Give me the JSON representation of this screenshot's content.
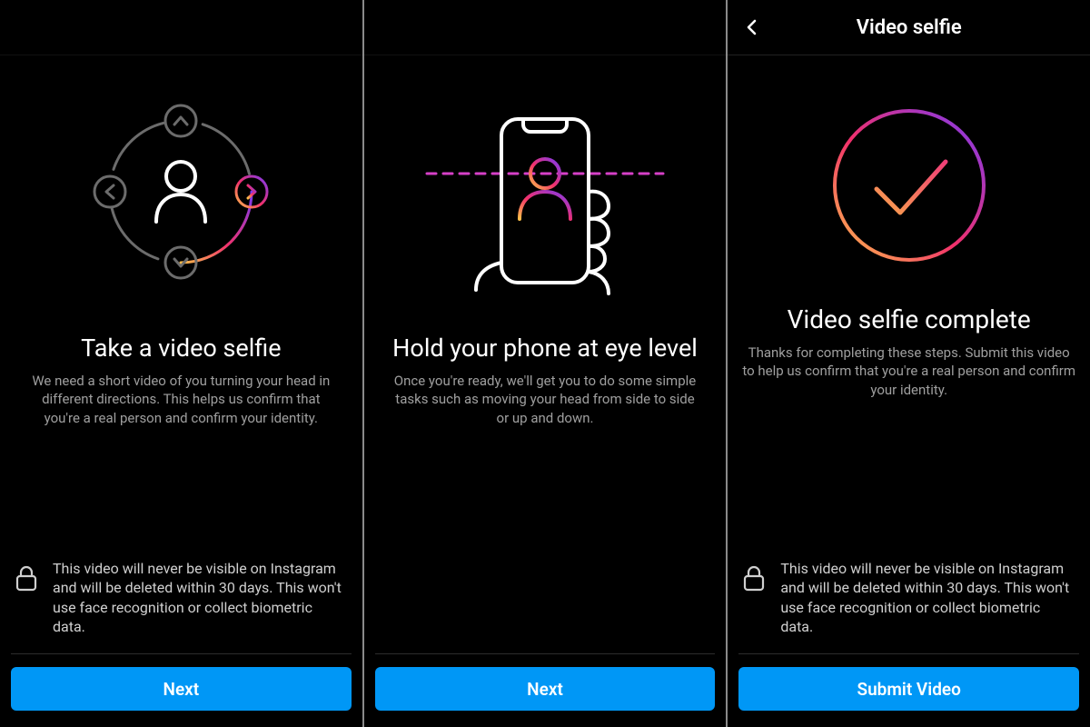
{
  "panels": [
    {
      "heading": "Take a video selfie",
      "body": "We need a short video of you turning your head in different directions. This helps us confirm that you're a real person and confirm your identity.",
      "lock_text": "This video will never be visible on Instagram and will be deleted within 30 days. This won't use face recognition or collect biometric data.",
      "button": "Next"
    },
    {
      "heading": "Hold your phone at eye level",
      "body": "Once you're ready, we'll get you to do some simple tasks such as moving your head from side to side or up and down.",
      "button": "Next"
    },
    {
      "header_title": "Video selfie",
      "heading": "Video selfie complete",
      "body": "Thanks for completing these steps. Submit this video to help us confirm that you're a real person and confirm your identity.",
      "lock_text": "This video will never be visible on Instagram and will be deleted within 30 days. This won't use face recognition or collect biometric data.",
      "button": "Submit Video"
    }
  ]
}
